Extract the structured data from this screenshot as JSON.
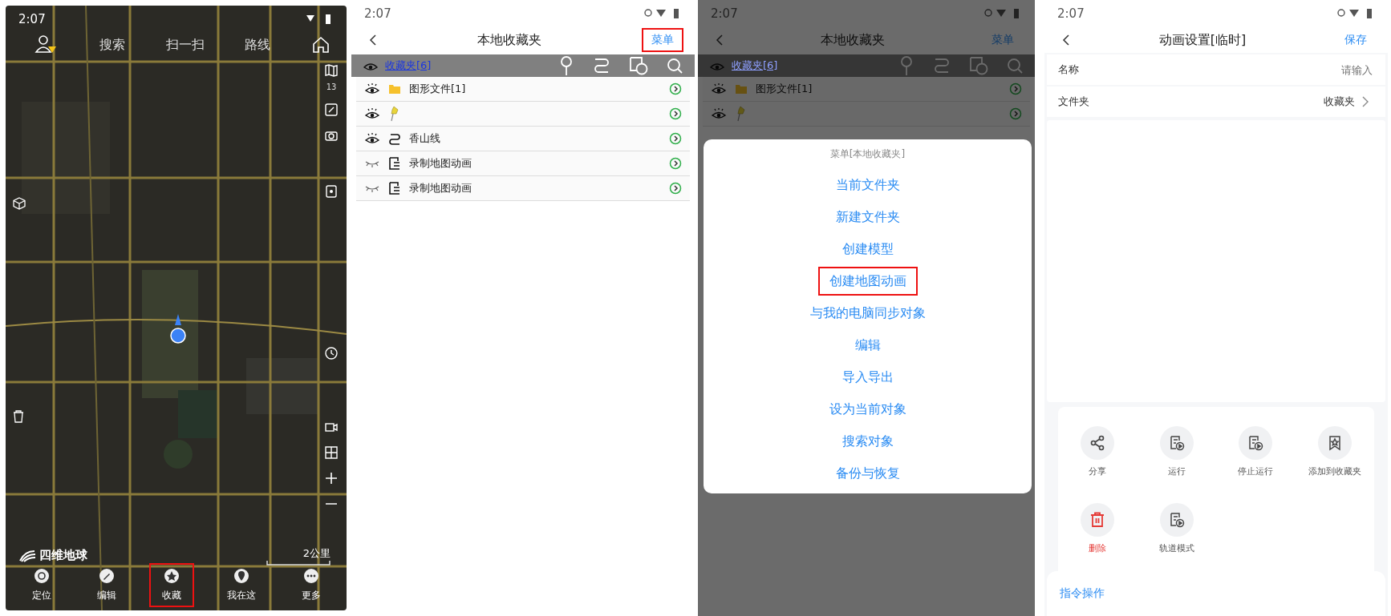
{
  "map_screen": {
    "status_time": "2:07",
    "top_bar": [
      "搜索",
      "扫一扫",
      "路线"
    ],
    "layer_count": "13",
    "logo": "四维地球",
    "scale": "2公里",
    "nav": [
      {
        "kind": "locate",
        "label": "定位",
        "highlighted": false
      },
      {
        "kind": "edit",
        "label": "编辑",
        "highlighted": false
      },
      {
        "kind": "favorite",
        "label": "收藏",
        "highlighted": true
      },
      {
        "kind": "here",
        "label": "我在这",
        "highlighted": false
      },
      {
        "kind": "more",
        "label": "更多",
        "highlighted": false
      }
    ]
  },
  "favorites_screen": {
    "status_time": "2:07",
    "title": "本地收藏夹",
    "menu_button": {
      "label": "菜单",
      "highlighted": true
    },
    "folder_bar": {
      "label": "收藏夹[6]"
    },
    "items": [
      {
        "kind": "folder",
        "label": "图形文件[1]",
        "visible": true
      },
      {
        "kind": "pin",
        "visible": true
      },
      {
        "kind": "route",
        "label": "香山线",
        "visible": true
      },
      {
        "kind": "animation",
        "label": "录制地图动画",
        "visible": false
      },
      {
        "kind": "animation",
        "label": "录制地图动画",
        "visible": false
      }
    ]
  },
  "menu_screen": {
    "status_time": "2:07",
    "title": "本地收藏夹",
    "menu_button": {
      "label": "菜单",
      "highlighted": false
    },
    "folder_bar": {
      "label": "收藏夹[6]"
    },
    "items": [
      {
        "kind": "folder",
        "label": "图形文件[1]",
        "visible": true
      },
      {
        "kind": "pin",
        "visible": true
      }
    ],
    "dialog": {
      "title": "菜单[本地收藏夹]",
      "options": [
        {
          "label": "当前文件夹",
          "highlighted": false
        },
        {
          "label": "新建文件夹",
          "highlighted": false
        },
        {
          "label": "创建模型",
          "highlighted": false
        },
        {
          "label": "创建地图动画",
          "highlighted": true
        },
        {
          "label": "与我的电脑同步对象",
          "highlighted": false
        },
        {
          "label": "编辑",
          "highlighted": false
        },
        {
          "label": "导入导出",
          "highlighted": false
        },
        {
          "label": "设为当前对象",
          "highlighted": false
        },
        {
          "label": "搜索对象",
          "highlighted": false
        },
        {
          "label": "备份与恢复",
          "highlighted": false
        }
      ]
    }
  },
  "animation_screen": {
    "status_time": "2:07",
    "title": "动画设置[临时]",
    "save_button": "保存",
    "fields": [
      {
        "label": "名称",
        "placeholder": "请输入"
      },
      {
        "label": "文件夹",
        "value": "收藏夹"
      }
    ],
    "actions": [
      {
        "kind": "share",
        "label": "分享",
        "danger": false
      },
      {
        "kind": "script",
        "label": "运行",
        "danger": false
      },
      {
        "kind": "script",
        "label": "停止运行",
        "danger": false
      },
      {
        "kind": "bookmark",
        "label": "添加到收藏夹",
        "danger": false
      },
      {
        "kind": "trash",
        "label": "删除",
        "danger": true
      },
      {
        "kind": "script",
        "label": "轨道模式",
        "danger": false
      }
    ],
    "footer": "指令操作"
  }
}
